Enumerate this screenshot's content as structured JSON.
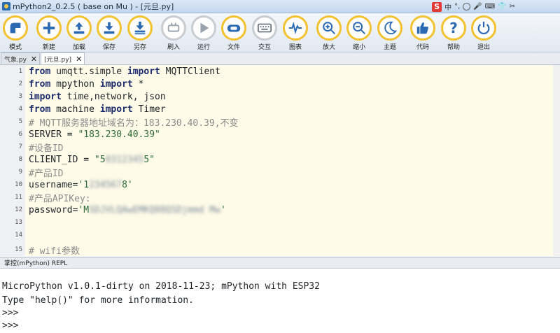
{
  "window": {
    "title": "mPython2_0.2.5 ( base on Mu ) - [元旦.py]",
    "ime_items": [
      "中",
      "°,",
      "☺",
      "🎤",
      "⌨",
      "👕",
      "✂"
    ]
  },
  "toolbar": {
    "buttons": [
      {
        "label": "模式",
        "icon": "mode-icon",
        "enabled": true
      },
      {
        "label": "新建",
        "icon": "plus-icon",
        "enabled": true
      },
      {
        "label": "加载",
        "icon": "upload-icon",
        "enabled": true
      },
      {
        "label": "保存",
        "icon": "download-icon",
        "enabled": true
      },
      {
        "label": "另存",
        "icon": "save-as-icon",
        "enabled": true
      },
      {
        "label": "刷入",
        "icon": "flash-icon",
        "enabled": false
      },
      {
        "label": "运行",
        "icon": "play-icon",
        "enabled": false
      },
      {
        "label": "文件",
        "icon": "files-icon",
        "enabled": true
      },
      {
        "label": "交互",
        "icon": "keyboard-icon",
        "enabled": false
      },
      {
        "label": "图表",
        "icon": "plotter-icon",
        "enabled": true
      },
      {
        "label": "放大",
        "icon": "zoom-in-icon",
        "enabled": true
      },
      {
        "label": "缩小",
        "icon": "zoom-out-icon",
        "enabled": true
      },
      {
        "label": "主题",
        "icon": "moon-icon",
        "enabled": true
      },
      {
        "label": "代码",
        "icon": "thumbs-up-icon",
        "enabled": true
      },
      {
        "label": "帮助",
        "icon": "help-icon",
        "enabled": true
      },
      {
        "label": "退出",
        "icon": "power-icon",
        "enabled": true
      }
    ]
  },
  "tabs": [
    {
      "label": "气象.py",
      "active": false
    },
    {
      "label": "[元旦.py]",
      "active": true
    }
  ],
  "editor": {
    "lines": [
      {
        "n": "1",
        "code": "from umqtt.simple import MQTTClient"
      },
      {
        "n": "2",
        "code": "from mpython import *"
      },
      {
        "n": "3",
        "code": "import time,network, json"
      },
      {
        "n": "4",
        "code": "from machine import Timer"
      },
      {
        "n": "5",
        "code": "# MQTT服务器地址域名为：183.230.40.39,不变"
      },
      {
        "n": "6",
        "code": "SERVER = \"183.230.40.39\""
      },
      {
        "n": "7",
        "code": "#设备ID"
      },
      {
        "n": "8",
        "code": "CLIENT_ID = \"5031██████5\""
      },
      {
        "n": "9",
        "code": "#产品ID"
      },
      {
        "n": "10",
        "code": "username='1██████8'"
      },
      {
        "n": "11",
        "code": "#产品APIKey:"
      },
      {
        "n": "12",
        "code": "password='M██████████████████████████████'"
      },
      {
        "n": "13",
        "code": ""
      },
      {
        "n": "14",
        "code": ""
      },
      {
        "n": "15",
        "code": "# wifi参数"
      }
    ]
  },
  "repl": {
    "title": "掌控(mPython) REPL",
    "lines": [
      "",
      "MicroPython v1.0.1-dirty on 2018-11-23; mPython with ESP32",
      "Type \"help()\" for more information.",
      ">>>",
      ">>>"
    ]
  }
}
